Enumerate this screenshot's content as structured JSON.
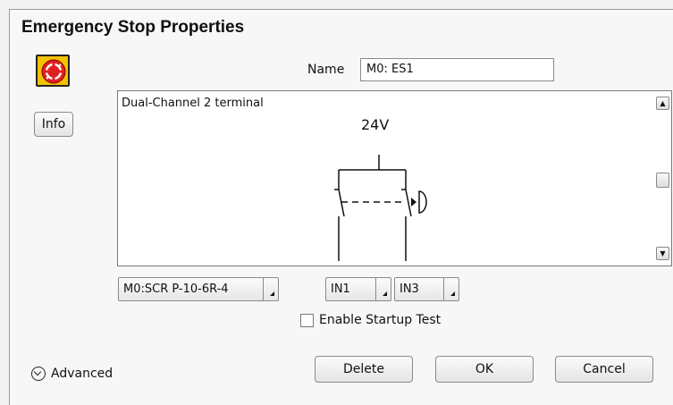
{
  "dialog": {
    "title": "Emergency Stop Properties",
    "info_label": "Info",
    "name_label": "Name",
    "name_value": "M0: ES1",
    "diagram": {
      "caption": "Dual-Channel 2 terminal",
      "voltage": "24V"
    },
    "module_select": "M0:SCR P-10-6R-4",
    "input1_select": "IN1",
    "input2_select": "IN3",
    "startup_test": {
      "label": "Enable Startup Test",
      "checked": false
    },
    "advanced_label": "Advanced",
    "buttons": {
      "delete": "Delete",
      "ok": "OK",
      "cancel": "Cancel"
    },
    "icons": [
      "emergency-stop-icon",
      "scroll-up-icon",
      "scroll-down-icon",
      "chevron-down-icon"
    ],
    "colors": {
      "estop_yellow": "#f2c200",
      "estop_red": "#e02020"
    }
  }
}
